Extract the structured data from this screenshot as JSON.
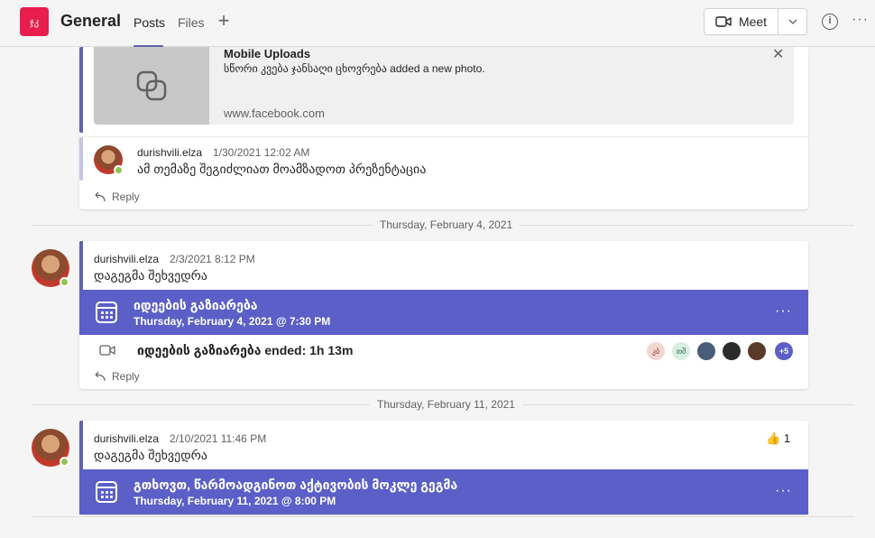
{
  "header": {
    "team_initials": "ჯკ",
    "channel_name": "General",
    "tabs": [
      "Posts",
      "Files"
    ],
    "meet_label": "Meet"
  },
  "preview": {
    "title": "Mobile Uploads",
    "description": "სწორი კვება ჯანსაღი ცხოვრება added a new photo.",
    "url": "www.facebook.com"
  },
  "reply_message": {
    "author": "durishvili.elza",
    "time": "1/30/2021 12:02 AM",
    "text": "ამ თემაზე შეგიძლიათ მოამზადოთ პრეზენტაცია"
  },
  "reply_label": "Reply",
  "dates": [
    "Thursday, February 4, 2021",
    "Thursday, February 11, 2021"
  ],
  "post1": {
    "author": "durishvili.elza",
    "time": "2/3/2021 8:12 PM",
    "text": "დაგეგმა შეხვედრა",
    "meeting_title": "იდეების გაზიარება",
    "meeting_date": "Thursday, February 4, 2021 @ 7:30 PM",
    "ended_text": "იდეების გაზიარება ended: 1h 13m",
    "participants": [
      {
        "initials": "კბ",
        "color": "#f4d6d1",
        "text_color": "#8a3f33"
      },
      {
        "initials": "თშ",
        "color": "#d9efe2",
        "text_color": "#2e6b47"
      },
      {
        "initials": "",
        "color": "#4a5d78",
        "text_color": "#fff"
      },
      {
        "initials": "",
        "color": "#2b2b2b",
        "text_color": "#fff"
      },
      {
        "initials": "",
        "color": "#5a3a2a",
        "text_color": "#fff"
      }
    ],
    "more_participants": "+5"
  },
  "post2": {
    "author": "durishvili.elza",
    "time": "2/10/2021 11:46 PM",
    "text": "დაგეგმა შეხვედრა",
    "reaction_count": "1",
    "meeting_title": "გთხოვთ, წარმოადგინოთ აქტივობის მოკლე გეგმა",
    "meeting_date": "Thursday, February 11, 2021 @ 8:00 PM"
  }
}
